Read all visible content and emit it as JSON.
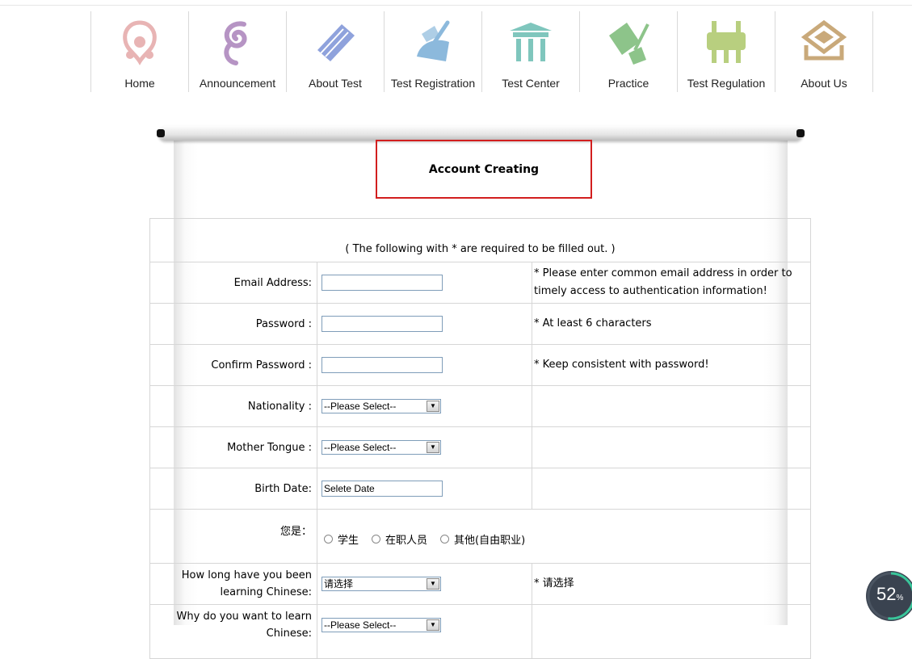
{
  "nav": [
    {
      "label": "Home",
      "icon": "home-icon",
      "color": "#e8b4b4"
    },
    {
      "label": "Announcement",
      "icon": "announcement-icon",
      "color": "#b694c4"
    },
    {
      "label": "About Test",
      "icon": "about-test-icon",
      "color": "#8fa2dc"
    },
    {
      "label": "Test Registration",
      "icon": "registration-icon",
      "color": "#8cb9dc"
    },
    {
      "label": "Test Center",
      "icon": "test-center-icon",
      "color": "#7fc6bd"
    },
    {
      "label": "Practice",
      "icon": "practice-icon",
      "color": "#8dc48a"
    },
    {
      "label": "Test Regulation",
      "icon": "regulation-icon",
      "color": "#b8cf7f"
    },
    {
      "label": "About Us",
      "icon": "about-us-icon",
      "color": "#c9a97a"
    }
  ],
  "form": {
    "title": "Account Creating",
    "note": "( The following with * are required to be filled out. )",
    "email": {
      "label": "Email Address:",
      "value": "",
      "hint": "*  Please enter common email address in order to timely access to authentication information!"
    },
    "password": {
      "label": "Password :",
      "value": "",
      "hint": "*  At least 6 characters"
    },
    "confirm": {
      "label": "Confirm Password :",
      "value": "",
      "hint": "*  Keep consistent with password!"
    },
    "nationality": {
      "label": "Nationality :",
      "selected": "--Please Select--"
    },
    "tongue": {
      "label": "Mother Tongue :",
      "selected": "--Please Select--"
    },
    "birth": {
      "label": "Birth Date:",
      "value": "Selete Date"
    },
    "identity": {
      "label": "您是：",
      "options": [
        "学生",
        "在职人员",
        "其他(自由职业)"
      ]
    },
    "howlong": {
      "label": "How long have you been learning Chinese:",
      "selected": "请选择",
      "hint": "* 请选择"
    },
    "why": {
      "label": "Why do you want to learn Chinese:",
      "selected": "--Please Select--"
    }
  },
  "progress": {
    "value": "52",
    "unit": "%",
    "fraction": 0.52
  }
}
